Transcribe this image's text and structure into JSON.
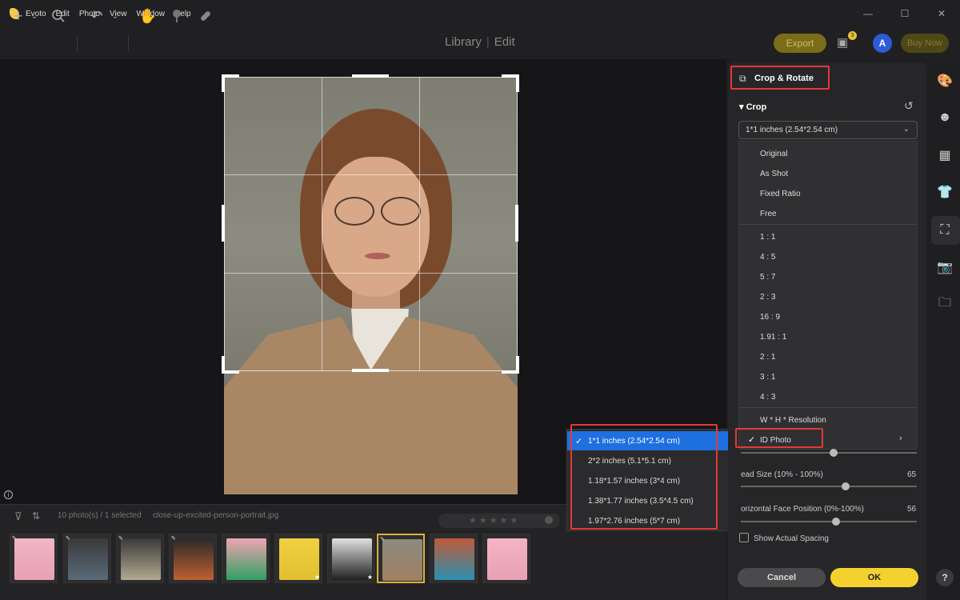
{
  "menubar": {
    "app_name": "Evoto",
    "items": [
      "Edit",
      "Photo",
      "View",
      "Window",
      "Help"
    ]
  },
  "toolbar": {
    "mode_library": "Library",
    "mode_separator": "|",
    "mode_edit": "Edit",
    "export_label": "Export",
    "notification_count": "3",
    "avatar_letter": "A",
    "buy_now_label": "Buy Now"
  },
  "filmstrip": {
    "count_text": "10 photo(s) / 1 selected",
    "filename": "close-up-excited-person-portrait.jpg"
  },
  "id_photo_submenu": {
    "items": [
      "1*1 inches (2.54*2.54 cm)",
      "2*2 inches (5.1*5.1 cm)",
      "1.18*1.57 inches (3*4 cm)",
      "1.38*1.77 inches (3.5*4.5 cm)",
      "1.97*2.76 inches (5*7 cm)"
    ],
    "selected_index": 0
  },
  "panel": {
    "title": "Crop & Rotate",
    "crop_section": "Crop",
    "crop_select_value": "1*1 inches (2.54*2.54 cm)",
    "dropdown": {
      "group1": [
        "Original",
        "As Shot",
        "Fixed Ratio",
        "Free"
      ],
      "group2": [
        "1 : 1",
        "4 : 5",
        "5 : 7",
        "2 : 3",
        "16 : 9",
        "1.91 : 1",
        "2 : 1",
        "3 : 1",
        "4 : 3"
      ],
      "group3": [
        "W * H * Resolution",
        "ID Photo"
      ],
      "checked": "ID Photo"
    },
    "head_size_label": "ead Size (10% - 100%)",
    "head_size_value": "65",
    "face_pos_label": "orizontal Face Position (0%-100%)",
    "face_pos_value": "56",
    "show_spacing_label": "Show Actual Spacing",
    "cancel_label": "Cancel",
    "ok_label": "OK"
  },
  "help_label": "?",
  "colors": {
    "accent_yellow": "#f5d130",
    "selection_blue": "#1e6fe0",
    "highlight_red": "#e53935",
    "avatar_blue": "#2e5bd6"
  },
  "icons": [
    "plus-icon",
    "chevron-down-icon",
    "search-icon",
    "undo-icon",
    "hand-icon",
    "tree-icon",
    "bandage-icon",
    "notification-icon",
    "palette-icon",
    "face-icon",
    "gradient-icon",
    "shirt-icon",
    "crop-icon",
    "camera-icon",
    "folder-eye-icon",
    "filter-icon",
    "sort-icon",
    "reset-icon",
    "info-icon",
    "checkmark-icon"
  ]
}
